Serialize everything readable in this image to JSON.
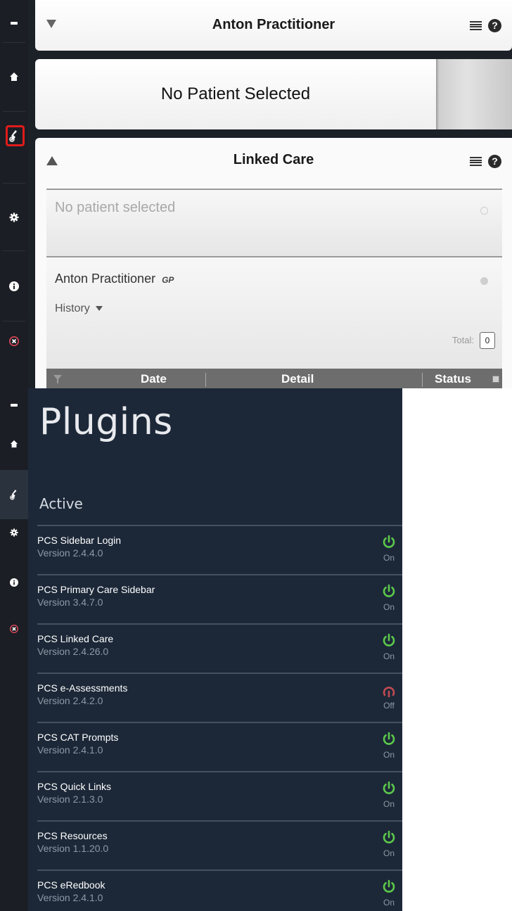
{
  "top_panel": {
    "user_card": {
      "title": "Anton Practitioner"
    },
    "patient_card": {
      "title": "No Patient Selected"
    },
    "linked_care": {
      "title": "Linked Care",
      "row1_text": "No patient selected",
      "row2_name": "Anton Practitioner",
      "row2_role": "GP",
      "history_label": "History",
      "total_label": "Total:",
      "total_value": "0",
      "table_headers": {
        "date": "Date",
        "detail": "Detail",
        "status": "Status"
      }
    },
    "highlight_color": "#e01b1b"
  },
  "bottom_panel": {
    "title": "Plugins",
    "section": "Active",
    "plugins": [
      {
        "name": "PCS Sidebar Login",
        "version": "Version  2.4.4.0",
        "state": "On"
      },
      {
        "name": "PCS Primary Care Sidebar",
        "version": "Version  3.4.7.0",
        "state": "On"
      },
      {
        "name": "PCS Linked Care",
        "version": "Version  2.4.26.0",
        "state": "On"
      },
      {
        "name": "PCS e-Assessments",
        "version": "Version  2.4.2.0",
        "state": "Off"
      },
      {
        "name": "PCS CAT Prompts",
        "version": "Version  2.4.1.0",
        "state": "On"
      },
      {
        "name": "PCS Quick Links",
        "version": "Version  2.1.3.0",
        "state": "On"
      },
      {
        "name": "PCS Resources",
        "version": "Version  1.1.20.0",
        "state": "On"
      },
      {
        "name": "PCS eRedbook",
        "version": "Version  2.4.1.0",
        "state": "On"
      }
    ],
    "on_color": "#5cc94b",
    "off_color": "#c24a52"
  },
  "icons": [
    "minimize-icon",
    "home-icon",
    "plugins-icon",
    "settings-icon",
    "info-icon",
    "close-icon",
    "menu-icon",
    "help-icon",
    "power-icon"
  ]
}
